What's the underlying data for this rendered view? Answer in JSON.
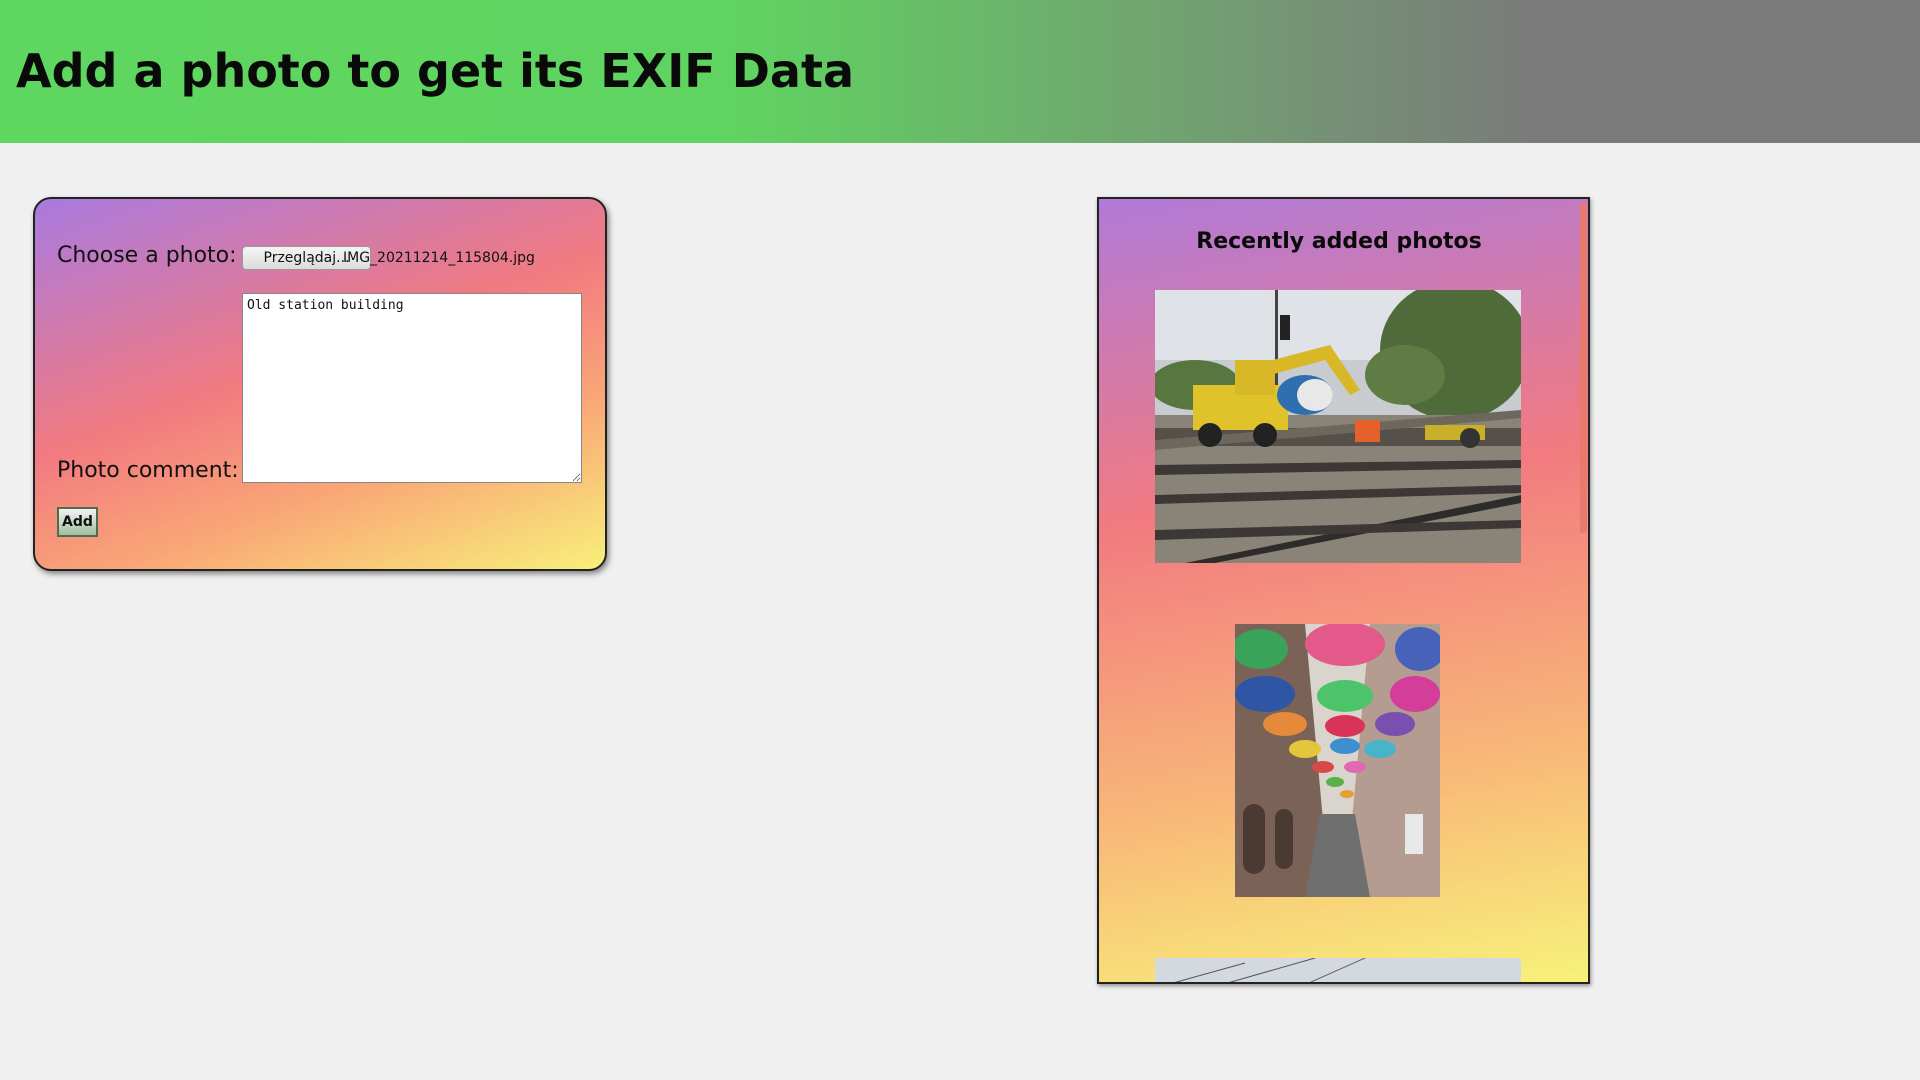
{
  "header": {
    "title": "Add a photo to get its EXIF Data"
  },
  "upload_form": {
    "choose_label": "Choose a photo:",
    "browse_label": "Przeglądaj...",
    "file_name": "IMG_20211214_115804.jpg",
    "comment_label": "Photo comment:",
    "comment_value": "Old station building",
    "add_label": "Add"
  },
  "recent": {
    "title": "Recently added photos",
    "photos": [
      {
        "subject": "excavator on railway tracks"
      },
      {
        "subject": "colorful umbrellas above a narrow street"
      },
      {
        "subject": "sky with overhead wires"
      }
    ]
  }
}
